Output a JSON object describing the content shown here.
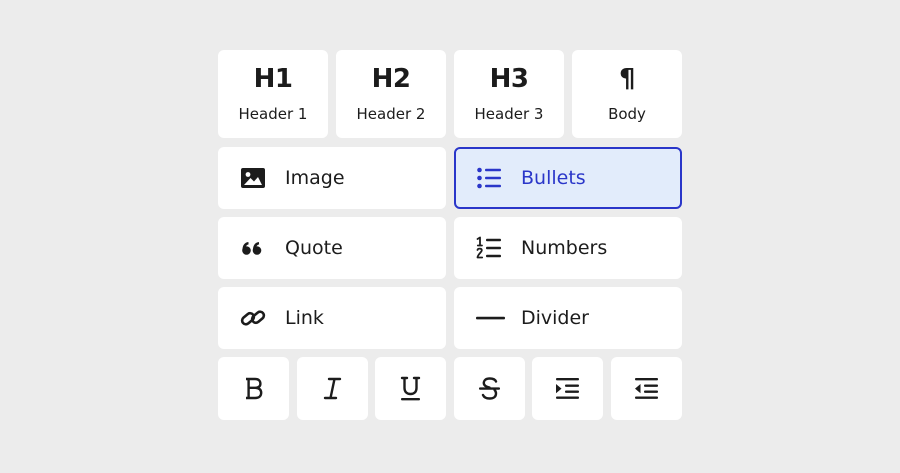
{
  "headings": [
    {
      "glyph": "H1",
      "label": "Header 1"
    },
    {
      "glyph": "H2",
      "label": "Header 2"
    },
    {
      "glyph": "H3",
      "label": "Header 3"
    },
    {
      "glyph": "¶",
      "label": "Body"
    }
  ],
  "blocks": {
    "image": {
      "label": "Image",
      "icon": "image-icon"
    },
    "bullets": {
      "label": "Bullets",
      "icon": "bullet-list-icon",
      "selected": true
    },
    "quote": {
      "label": "Quote",
      "icon": "quote-icon"
    },
    "numbers": {
      "label": "Numbers",
      "icon": "numbered-list-icon"
    },
    "link": {
      "label": "Link",
      "icon": "link-icon"
    },
    "divider": {
      "label": "Divider",
      "icon": "divider-icon"
    }
  },
  "format_tools": [
    "bold-icon",
    "italic-icon",
    "underline-icon",
    "strikethrough-icon",
    "indent-icon",
    "outdent-icon"
  ],
  "colors": {
    "accent": "#2a36c9",
    "selected_bg": "#e2ecfb",
    "card": "#ffffff",
    "background": "#ececec",
    "ink": "#1c1c1c"
  }
}
